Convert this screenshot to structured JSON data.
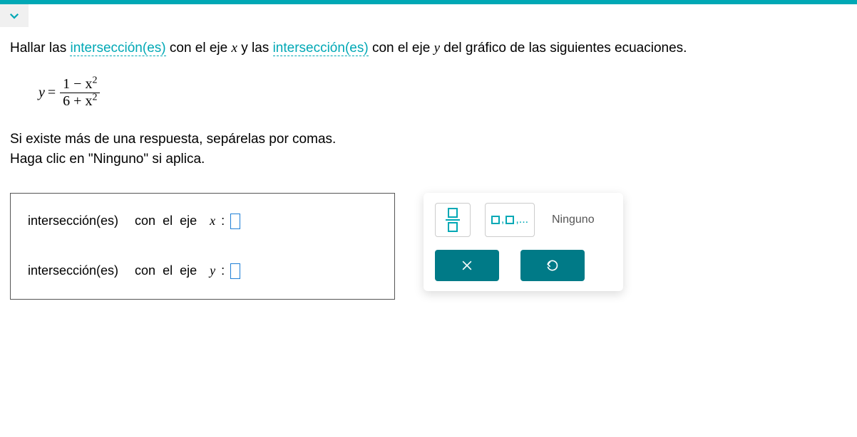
{
  "prompt": {
    "part1": "Hallar las ",
    "link1": "intersección(es)",
    "part2": " con el eje ",
    "var1": "x",
    "part3": " y las ",
    "link2": "intersección(es)",
    "part4": " con el eje ",
    "var2": "y",
    "part5": " del gráfico de las siguientes ecuaciones."
  },
  "equation": {
    "lhs": "y",
    "equals": "=",
    "numerator": "1 − x",
    "num_exp": "2",
    "denominator": "6 + x",
    "den_exp": "2"
  },
  "instructions": {
    "line1": "Si existe más de una respuesta, sepárelas por comas.",
    "line2": "Haga clic en \"Ninguno\" si aplica."
  },
  "answers": {
    "x_label_a": "intersección(es)",
    "x_label_b": "   con  el  eje  ",
    "x_var": "x",
    "x_colon": " : ",
    "y_label_a": "intersección(es)",
    "y_label_b": "   con  el  eje  ",
    "y_var": "y",
    "y_colon": " : "
  },
  "toolbox": {
    "none_label": "Ninguno"
  }
}
